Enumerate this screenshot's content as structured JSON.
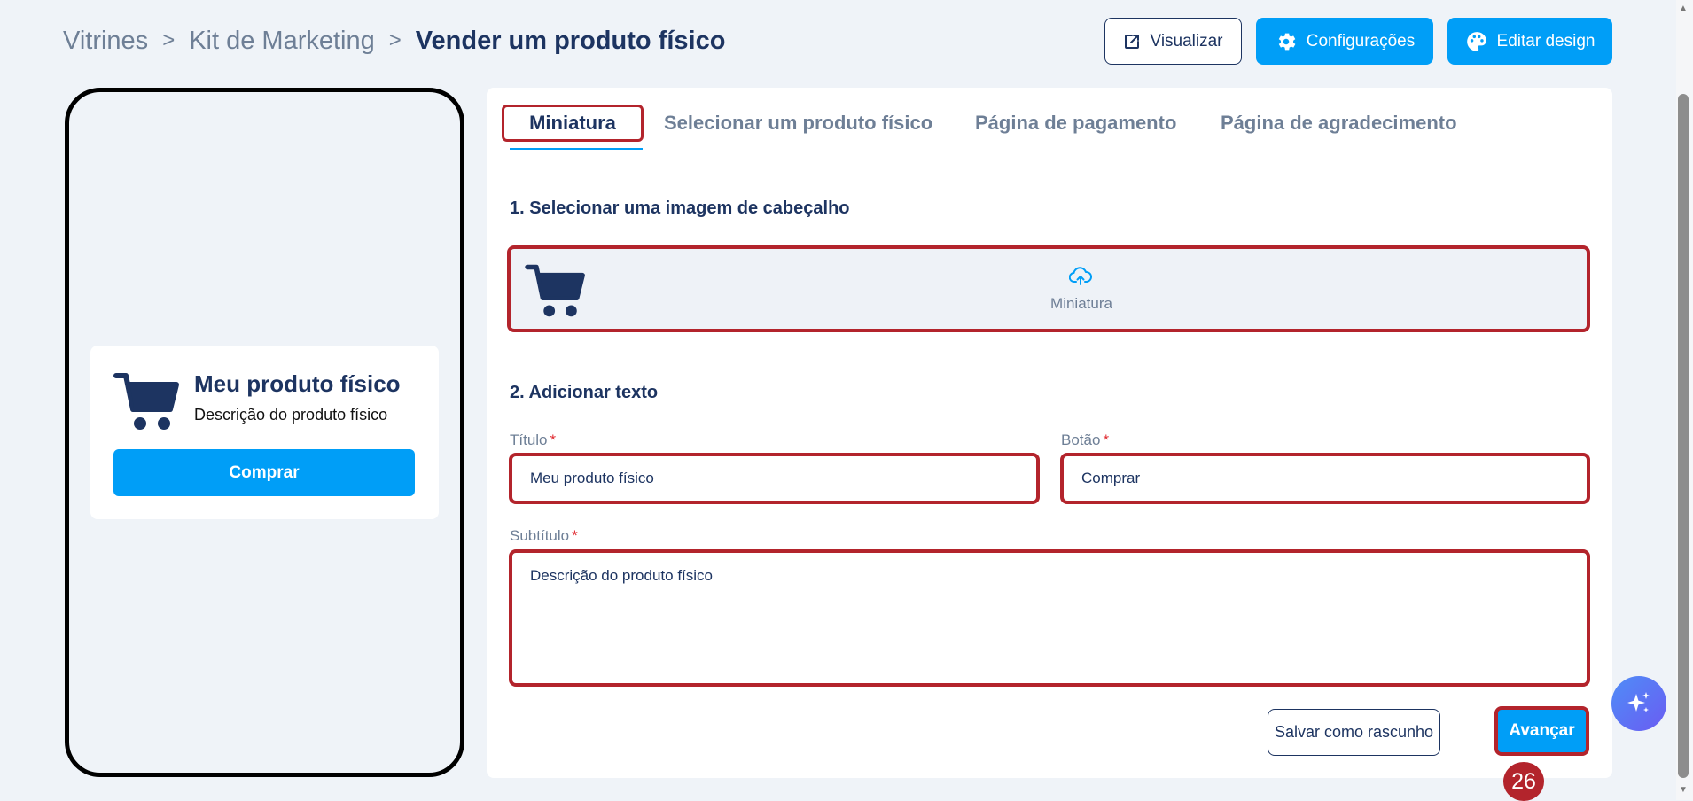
{
  "breadcrumb": {
    "items": [
      "Vitrines",
      "Kit de Marketing"
    ],
    "separator": ">",
    "current": "Vender um produto físico"
  },
  "header": {
    "preview_label": "Visualizar",
    "settings_label": "Configurações",
    "edit_design_label": "Editar design"
  },
  "preview_card": {
    "title": "Meu produto físico",
    "description": "Descrição do produto físico",
    "button_label": "Comprar"
  },
  "tabs": [
    {
      "label": "Miniatura",
      "active": true
    },
    {
      "label": "Selecionar um produto físico",
      "active": false
    },
    {
      "label": "Página de pagamento",
      "active": false
    },
    {
      "label": "Página de agradecimento",
      "active": false
    }
  ],
  "step1": {
    "heading": "1. Selecionar uma imagem de cabeçalho",
    "upload_label": "Miniatura"
  },
  "step2": {
    "heading": "2. Adicionar texto",
    "title_label": "Título",
    "title_value": "Meu produto físico",
    "button_label": "Botão",
    "button_value": "Comprar",
    "subtitle_label": "Subtítulo",
    "subtitle_value": "Descrição do produto físico",
    "required_mark": "*"
  },
  "footer": {
    "draft_label": "Salvar como rascunho",
    "next_label": "Avançar",
    "step_number": "26"
  },
  "colors": {
    "primary": "#009ef7",
    "navy": "#1d3461",
    "highlight": "#b3242c",
    "background": "#eff3f8"
  },
  "icons": [
    "external-link-icon",
    "gear-icon",
    "palette-icon",
    "cart-icon",
    "upload-cloud-icon",
    "sparkle-icon",
    "chevron-right-icon"
  ]
}
